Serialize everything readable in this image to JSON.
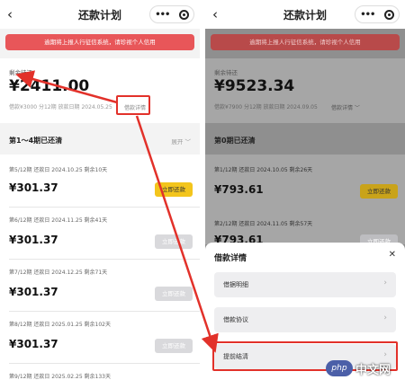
{
  "left": {
    "nav": {
      "title": "还款计划"
    },
    "warning": "逾期将上报人行征信系统，请珍视个人信用",
    "summary": {
      "label": "剩余待还",
      "amount": "¥2411.00",
      "info": "借款¥3000 分12期  放款日期 2024.05.25",
      "detail_link": "借款详情"
    },
    "section": {
      "title": "第1～4期已还清",
      "expand": "展开 ﹀"
    },
    "rows": [
      {
        "label": "第5/12期  还款日 2024.10.25 剩余10天",
        "amount": "¥301.37",
        "button": "立即还款"
      },
      {
        "label": "第6/12期  还款日 2024.11.25 剩余41天",
        "amount": "¥301.37",
        "button": "立即还款"
      },
      {
        "label": "第7/12期  还款日 2024.12.25 剩余71天",
        "amount": "¥301.37",
        "button": "立即还款"
      },
      {
        "label": "第8/12期  还款日 2025.01.25 剩余102天",
        "amount": "¥301.37",
        "button": "立即还款"
      },
      {
        "label": "第9/12期  还款日 2025.02.25 剩余133天"
      }
    ]
  },
  "right": {
    "nav": {
      "title": "还款计划"
    },
    "warning": "逾期将上报人行征信系统，请珍视个人信用",
    "summary": {
      "label": "剩余待还",
      "amount": "¥9523.34",
      "info": "借款¥7900 分12期  放款日期 2024.09.05",
      "detail_link": "借款详情 ﹀"
    },
    "section": {
      "title": "第0期已还清"
    },
    "rows": [
      {
        "label": "第1/12期  还款日 2024.10.05 剩余26天",
        "amount": "¥793.61",
        "button": "立即还款"
      },
      {
        "label": "第2/12期  还款日 2024.11.05 剩余57天",
        "amount": "¥793.61",
        "button": "立即还款"
      }
    ],
    "sheet": {
      "title": "借款详情",
      "items": [
        {
          "label": "借据明细"
        },
        {
          "label": "借款协议"
        },
        {
          "label": "提前结清"
        }
      ]
    }
  },
  "watermark": {
    "logo": "php",
    "text": "中文网"
  },
  "colors": {
    "warning": "#e85659",
    "pay_active": "#f3c51c",
    "highlight": "#e2312a"
  },
  "icons": {
    "back": "chevron-left-icon",
    "more": "more-dots-icon",
    "target": "target-icon",
    "close": "close-icon",
    "chevron": "chevron-right-icon"
  }
}
